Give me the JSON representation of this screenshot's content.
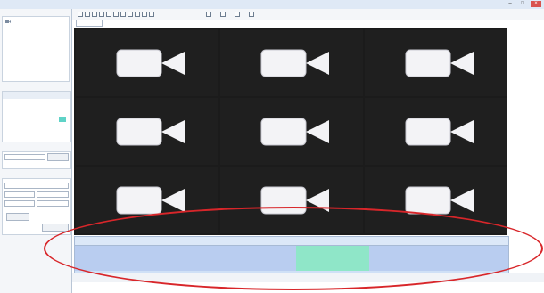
{
  "window": {
    "close_glyph": "×",
    "min_glyph": "–",
    "max_glyph": "□"
  },
  "left_panel": {
    "title": "",
    "tree": [
      ""
    ],
    "tabs": [
      "",
      "",
      ""
    ],
    "calendar": {
      "header": [
        "",
        "",
        ""
      ],
      "days": [
        "",
        "",
        "",
        "",
        "",
        "",
        "",
        "",
        "",
        "",
        "",
        "",
        "",
        "",
        "",
        "",
        "",
        "",
        "",
        "",
        "",
        "",
        "",
        "",
        "",
        "",
        "",
        "",
        "",
        "",
        "",
        "",
        "",
        "",
        ""
      ],
      "selected_index": 20
    },
    "search_title": "",
    "bottom_title": "",
    "buttons": [
      "",
      ""
    ],
    "footer": ""
  },
  "toolbar": {
    "icons": [
      "play-icon",
      "stop-icon",
      "rewind-icon",
      "forward-icon",
      "prev-icon",
      "next-icon",
      "slow-icon",
      "fast-icon",
      "snapshot-icon",
      "clip-icon",
      "layout-icon",
      "settings-icon",
      "zoom-icon",
      "export-icon",
      "close-icon"
    ],
    "tab_label": ""
  },
  "cameras": [
    {
      "icon": "camera-icon"
    },
    {
      "icon": "camera-icon"
    },
    {
      "icon": "camera-icon"
    },
    {
      "icon": "camera-icon"
    },
    {
      "icon": "camera-icon"
    },
    {
      "icon": "camera-icon"
    },
    {
      "icon": "camera-icon"
    },
    {
      "icon": "camera-icon"
    },
    {
      "icon": "camera-icon"
    }
  ],
  "timeline": {
    "ticks": [
      "",
      "",
      "",
      "",
      "",
      "",
      "",
      "",
      "",
      "",
      "",
      "",
      "",
      "",
      "",
      "",
      "",
      "",
      "",
      "",
      "",
      "",
      "",
      ""
    ],
    "colors": {
      "base": "#cfe0f6",
      "motion": "#8fe6c8",
      "highlight": "#b9cdf0"
    },
    "highlight_fraction": [
      0.51,
      0.68
    ]
  },
  "status": [
    "",
    "",
    "",
    ""
  ],
  "accent": "#d8262a",
  "watermark": ""
}
